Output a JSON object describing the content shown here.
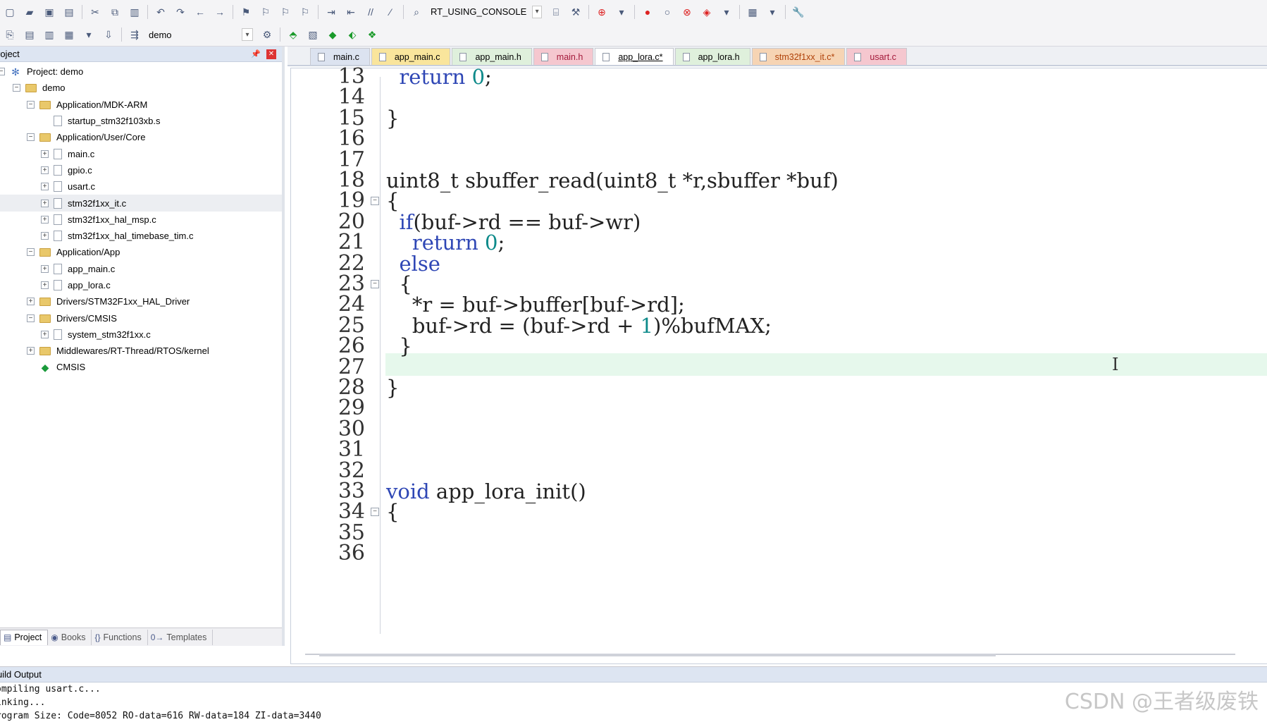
{
  "toolbar1": {
    "target_combo": "RT_USING_CONSOLE"
  },
  "toolbar2": {
    "project_combo": "demo"
  },
  "project_panel": {
    "title": "roject",
    "tree": [
      {
        "label": "Project: demo",
        "level": 0,
        "kind": "proj",
        "toggle": "−"
      },
      {
        "label": "demo",
        "level": 1,
        "kind": "folder",
        "toggle": "−"
      },
      {
        "label": "Application/MDK-ARM",
        "level": 2,
        "kind": "folder",
        "toggle": "−"
      },
      {
        "label": "startup_stm32f103xb.s",
        "level": 3,
        "kind": "file",
        "toggle": ""
      },
      {
        "label": "Application/User/Core",
        "level": 2,
        "kind": "folder",
        "toggle": "−"
      },
      {
        "label": "main.c",
        "level": 3,
        "kind": "file",
        "toggle": "+"
      },
      {
        "label": "gpio.c",
        "level": 3,
        "kind": "file",
        "toggle": "+"
      },
      {
        "label": "usart.c",
        "level": 3,
        "kind": "file",
        "toggle": "+"
      },
      {
        "label": "stm32f1xx_it.c",
        "level": 3,
        "kind": "file",
        "toggle": "+",
        "selected": true
      },
      {
        "label": "stm32f1xx_hal_msp.c",
        "level": 3,
        "kind": "file",
        "toggle": "+"
      },
      {
        "label": "stm32f1xx_hal_timebase_tim.c",
        "level": 3,
        "kind": "file",
        "toggle": "+"
      },
      {
        "label": "Application/App",
        "level": 2,
        "kind": "folder",
        "toggle": "−"
      },
      {
        "label": "app_main.c",
        "level": 3,
        "kind": "file",
        "toggle": "+"
      },
      {
        "label": "app_lora.c",
        "level": 3,
        "kind": "file",
        "toggle": "+"
      },
      {
        "label": "Drivers/STM32F1xx_HAL_Driver",
        "level": 2,
        "kind": "folder",
        "toggle": "+"
      },
      {
        "label": "Drivers/CMSIS",
        "level": 2,
        "kind": "folder",
        "toggle": "−"
      },
      {
        "label": "system_stm32f1xx.c",
        "level": 3,
        "kind": "file",
        "toggle": "+"
      },
      {
        "label": "Middlewares/RT-Thread/RTOS/kernel",
        "level": 2,
        "kind": "folder",
        "toggle": "+"
      },
      {
        "label": "CMSIS",
        "level": 2,
        "kind": "gem",
        "toggle": ""
      }
    ],
    "bottom_tabs": [
      {
        "label": "Project",
        "icon": "▤",
        "active": true
      },
      {
        "label": "Books",
        "icon": "◉",
        "active": false
      },
      {
        "label": "Functions",
        "icon": "{}",
        "active": false
      },
      {
        "label": "Templates",
        "icon": "0→",
        "active": false
      }
    ]
  },
  "editor_tabs": [
    {
      "label": "main.c",
      "style": "c"
    },
    {
      "label": "app_main.c",
      "style": "y"
    },
    {
      "label": "app_main.h",
      "style": "h"
    },
    {
      "label": "main.h",
      "style": "pk"
    },
    {
      "label": "app_lora.c*",
      "style": "active"
    },
    {
      "label": "app_lora.h",
      "style": "h"
    },
    {
      "label": "stm32f1xx_it.c*",
      "style": "or"
    },
    {
      "label": "usart.c",
      "style": "pk"
    }
  ],
  "code_lines": [
    {
      "n": "13",
      "text": "  return 0;",
      "fold": ""
    },
    {
      "n": "14",
      "text": "",
      "fold": ""
    },
    {
      "n": "15",
      "text": "}",
      "fold": ""
    },
    {
      "n": "16",
      "text": "",
      "fold": ""
    },
    {
      "n": "17",
      "text": "",
      "fold": ""
    },
    {
      "n": "18",
      "text": "uint8_t sbuffer_read(uint8_t *r,sbuffer *buf)",
      "fold": ""
    },
    {
      "n": "19",
      "text": "{",
      "fold": "−"
    },
    {
      "n": "20",
      "text": "  if(buf->rd == buf->wr)",
      "fold": ""
    },
    {
      "n": "21",
      "text": "    return 0;",
      "fold": ""
    },
    {
      "n": "22",
      "text": "  else",
      "fold": ""
    },
    {
      "n": "23",
      "text": "  {",
      "fold": "−"
    },
    {
      "n": "24",
      "text": "    *r = buf->buffer[buf->rd];",
      "fold": ""
    },
    {
      "n": "25",
      "text": "    buf->rd = (buf->rd + 1)%bufMAX;",
      "fold": ""
    },
    {
      "n": "26",
      "text": "  }",
      "fold": ""
    },
    {
      "n": "27",
      "text": "",
      "fold": ""
    },
    {
      "n": "28",
      "text": "}",
      "fold": ""
    },
    {
      "n": "29",
      "text": "",
      "fold": ""
    },
    {
      "n": "30",
      "text": "",
      "fold": ""
    },
    {
      "n": "31",
      "text": "",
      "fold": ""
    },
    {
      "n": "32",
      "text": "",
      "fold": ""
    },
    {
      "n": "33",
      "text": "void app_lora_init()",
      "fold": ""
    },
    {
      "n": "34",
      "text": "{",
      "fold": "−"
    },
    {
      "n": "35",
      "text": "",
      "fold": ""
    },
    {
      "n": "36",
      "text": "",
      "fold": ""
    }
  ],
  "highlight_line": "25",
  "cursor_glyph": "I",
  "build_output": {
    "title": "uild Output",
    "lines": [
      "ompiling usart.c...",
      "inking...",
      "rogram Size: Code=8052 RO-data=616 RW-data=184 ZI-data=3440"
    ]
  },
  "watermark": "CSDN @王者级废铁",
  "colors": {
    "keyword": "#2f47b5",
    "number": "#0d8a8a",
    "current_line": "#e6f8ec",
    "panel_header": "#dde5f2"
  }
}
